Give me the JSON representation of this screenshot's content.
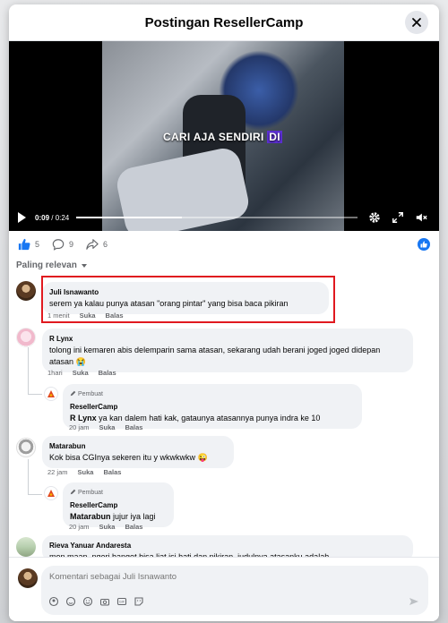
{
  "modal": {
    "title": "Postingan ResellerCamp"
  },
  "video": {
    "caption_plain": "CARI AJA SENDIRI ",
    "caption_highlight": "DI",
    "time_current": "0:09",
    "time_total": "0:24",
    "progress_fraction": 0.375
  },
  "stats": {
    "reactions": "5",
    "comments": "9",
    "shares": "6"
  },
  "sort_label": "Paling relevan",
  "comments": [
    {
      "name": "Juli Isnawanto",
      "text": "serem ya kalau punya atasan \"orang pintar\" yang bisa baca pikiran",
      "time": "1 menit",
      "like": "Suka",
      "reply": "Balas"
    },
    {
      "name": "R Lynx",
      "text": "tolong ini kemaren abis delemparin sama atasan, sekarang udah berani joged joged didepan atasan 😭",
      "time": "1hari",
      "like": "Suka",
      "reply": "Balas"
    },
    {
      "author_tag": "Pembuat",
      "name": "ResellerCamp",
      "mention": "R Lynx",
      "text": " ya kan dalem hati kak, gataunya atasannya punya indra ke 10",
      "time": "20 jam",
      "like": "Suka",
      "reply": "Balas"
    },
    {
      "name": "Matarabun",
      "text": "Kok bisa CGInya sekeren itu y wkwkwkw 😜",
      "time": "22 jam",
      "like": "Suka",
      "reply": "Balas"
    },
    {
      "author_tag": "Pembuat",
      "name": "ResellerCamp",
      "mention": "Matarabun",
      "text": " jujur iya lagi",
      "time": "20 jam",
      "like": "Suka",
      "reply": "Balas"
    },
    {
      "name": "Rieva Yanuar Andaresta",
      "text": "mon maap, ngeri banget bisa liat isi hati dan pikiran, judulnya atasanku adalah"
    }
  ],
  "composer": {
    "placeholder": "Komentari sebagai Juli Isnawanto"
  },
  "icons": {
    "close": "close-icon",
    "play": "play-icon",
    "settings": "gear-icon",
    "fullscreen": "fullscreen-icon",
    "mute": "speaker-muted-icon",
    "like": "thumbs-up-icon",
    "comment": "comment-icon",
    "share": "share-icon",
    "edit": "pencil-icon",
    "send": "send-icon"
  },
  "colors": {
    "accent": "#1877f2",
    "highlight_border": "#e0191f",
    "caption_highlight": "#5b2fd0"
  }
}
